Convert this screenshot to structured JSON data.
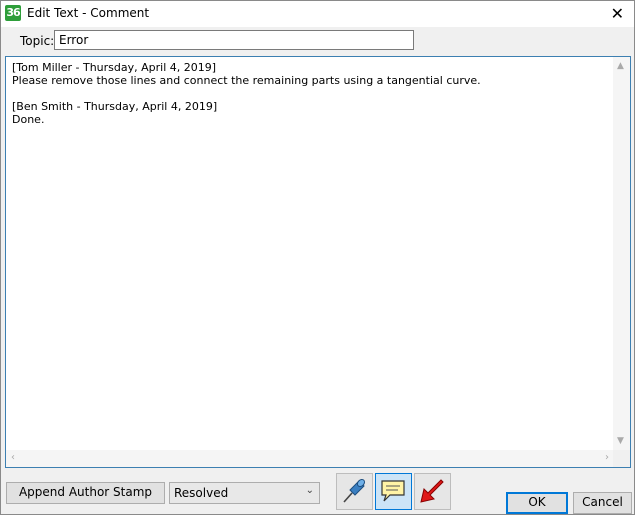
{
  "window": {
    "title": "Edit Text - Comment",
    "app_icon_text": "36"
  },
  "topic": {
    "label": "Topic:",
    "value": "Error"
  },
  "comment_text": "[Tom Miller - Thursday, April 4, 2019]\nPlease remove those lines and connect the remaining parts using a tangential curve.\n\n[Ben Smith - Thursday, April 4, 2019]\nDone.",
  "footer": {
    "append_label": "Append Author Stamp",
    "status_value": "Resolved",
    "ok_label": "OK",
    "cancel_label": "Cancel"
  },
  "icons": {
    "pin": "pushpin-icon",
    "note": "speech-bubble-icon",
    "arrow": "red-arrow-icon"
  }
}
